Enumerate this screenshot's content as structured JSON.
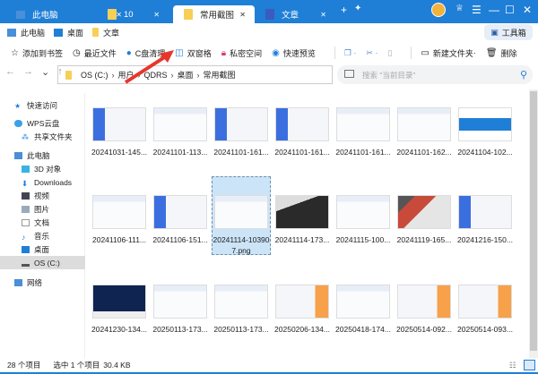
{
  "tabs": [
    {
      "label": "此电脑",
      "icon": "pc-icon"
    },
    {
      "label": "10",
      "icon": "folder-icon"
    },
    {
      "label": "常用截图",
      "icon": "folder-icon",
      "active": true
    },
    {
      "label": "文章",
      "icon": "doc-icon"
    }
  ],
  "bookmarks": [
    {
      "label": "此电脑"
    },
    {
      "label": "桌面"
    },
    {
      "label": "文章"
    }
  ],
  "toolbox_label": "工具箱",
  "toolbar": {
    "bookmark": "添加到书签",
    "recent": "最近文件",
    "cclean": "C盘清理",
    "dual": "双窗格",
    "private": "私密空间",
    "preview": "快速预览",
    "newfolder": "新建文件夹",
    "delete": "删除"
  },
  "address": {
    "crumbs": [
      "OS (C:)",
      "用户",
      "QDRS",
      "桌面",
      "常用截图"
    ]
  },
  "search": {
    "placeholder": "搜索 \"当前目录\""
  },
  "sidebar": {
    "quick": "快速访问",
    "wps": "WPS云盘",
    "shared": "共享文件夹",
    "pc": "此电脑",
    "obj3d": "3D 对象",
    "downloads": "Downloads",
    "video": "视频",
    "pics": "图片",
    "docs": "文档",
    "music": "音乐",
    "desktop": "桌面",
    "os": "OS (C:)",
    "network": "网络"
  },
  "files": [
    {
      "name": "20241031-145...",
      "kind": "blue"
    },
    {
      "name": "20241101-113...",
      "kind": "light"
    },
    {
      "name": "20241101-161...",
      "kind": "blue"
    },
    {
      "name": "20241101-161...",
      "kind": "blue"
    },
    {
      "name": "20241101-161...",
      "kind": "light"
    },
    {
      "name": "20241101-162...",
      "kind": "light"
    },
    {
      "name": "20241104-102...",
      "kind": "logo"
    },
    {
      "name": "20241106-111...",
      "kind": "light"
    },
    {
      "name": "20241106-151...",
      "kind": "blue"
    },
    {
      "name": "20241114-103907.png",
      "kind": "light",
      "selected": true
    },
    {
      "name": "20241114-173...",
      "kind": "keyboard"
    },
    {
      "name": "20241115-100...",
      "kind": "light"
    },
    {
      "name": "20241119-165...",
      "kind": "photo"
    },
    {
      "name": "20241216-150...",
      "kind": "blue"
    },
    {
      "name": "20241230-134...",
      "kind": "dark"
    },
    {
      "name": "20250113-173...",
      "kind": "light"
    },
    {
      "name": "20250113-173...",
      "kind": "light"
    },
    {
      "name": "20250206-134...",
      "kind": "orange"
    },
    {
      "name": "20250418-174...",
      "kind": "light"
    },
    {
      "name": "20250514-092...",
      "kind": "orange"
    },
    {
      "name": "20250514-093...",
      "kind": "orange"
    }
  ],
  "status": {
    "count": "28 个项目",
    "selected": "选中 1 个项目",
    "size": "30.4 KB"
  },
  "colors": {
    "accent": "#1f7fd6",
    "selection": "#cce4f7"
  }
}
